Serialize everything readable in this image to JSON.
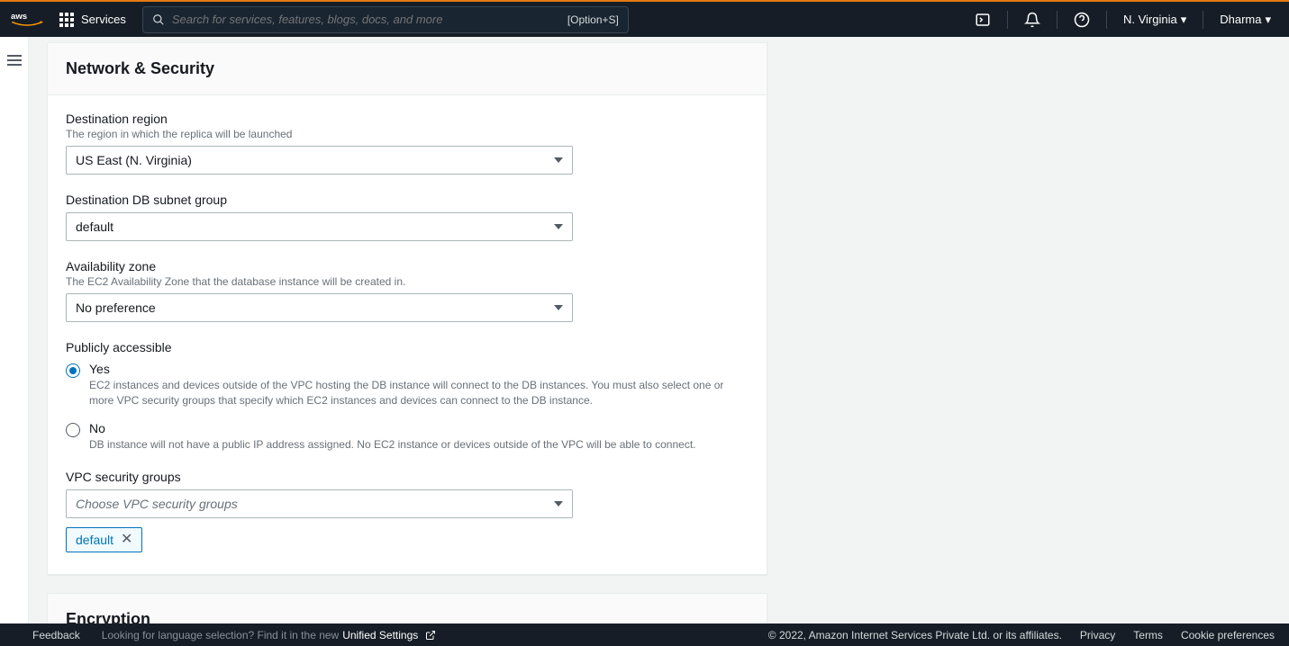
{
  "header": {
    "logo_text": "aws",
    "services_label": "Services",
    "search_placeholder": "Search for services, features, blogs, docs, and more",
    "search_shortcut": "[Option+S]",
    "region": "N. Virginia",
    "user": "Dharma"
  },
  "panel1": {
    "title": "Network & Security",
    "field_region_label": "Destination region",
    "field_region_desc": "The region in which the replica will be launched",
    "field_region_value": "US East (N. Virginia)",
    "field_subnet_label": "Destination DB subnet group",
    "field_subnet_value": "default",
    "field_az_label": "Availability zone",
    "field_az_desc": "The EC2 Availability Zone that the database instance will be created in.",
    "field_az_value": "No preference",
    "field_public_label": "Publicly accessible",
    "radio_yes_label": "Yes",
    "radio_yes_desc": "EC2 instances and devices outside of the VPC hosting the DB instance will connect to the DB instances. You must also select one or more VPC security groups that specify which EC2 instances and devices can connect to the DB instance.",
    "radio_no_label": "No",
    "radio_no_desc": "DB instance will not have a public IP address assigned. No EC2 instance or devices outside of the VPC will be able to connect.",
    "field_sg_label": "VPC security groups",
    "field_sg_placeholder": "Choose VPC security groups",
    "sg_token": "default"
  },
  "panel2": {
    "title": "Encryption"
  },
  "footer": {
    "feedback": "Feedback",
    "lang_hint": "Looking for language selection? Find it in the new ",
    "unified": "Unified Settings",
    "copyright": "© 2022, Amazon Internet Services Private Ltd. or its affiliates.",
    "privacy": "Privacy",
    "terms": "Terms",
    "cookies": "Cookie preferences"
  }
}
